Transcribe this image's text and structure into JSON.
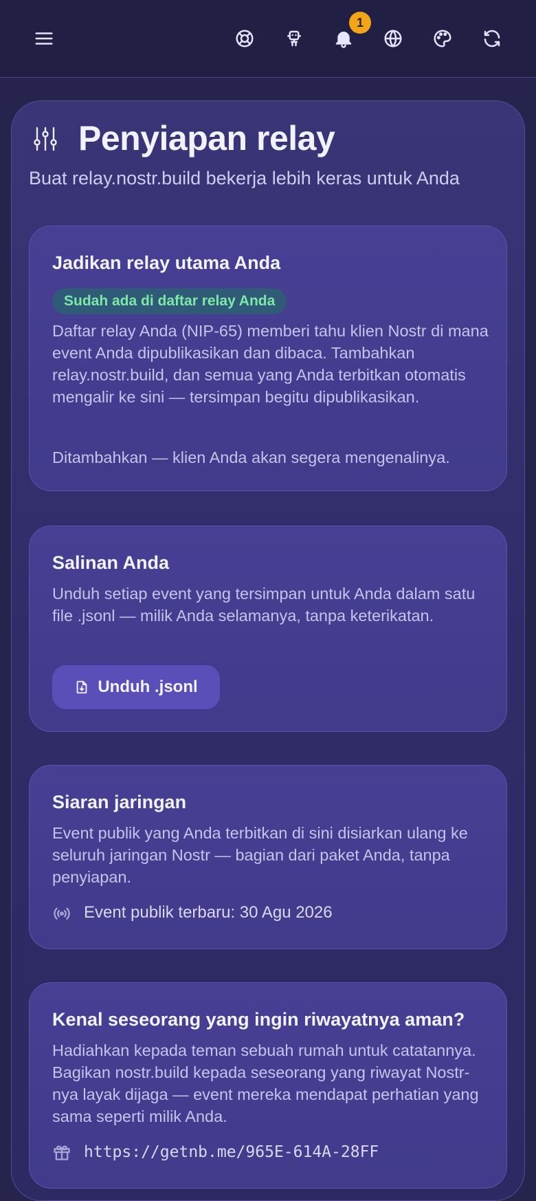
{
  "topbar": {
    "icons": [
      "menu-icon",
      "lifebuoy-icon",
      "robot-icon",
      "bell-icon",
      "globe-icon",
      "palette-icon",
      "refresh-icon"
    ],
    "notification_count": "1",
    "badge_color": "#f2a516"
  },
  "header": {
    "title": "Penyiapan relay",
    "subtitle": "Buat relay.nostr.build bekerja lebih keras untuk Anda"
  },
  "cards": {
    "primary": {
      "title": "Jadikan relay utama Anda",
      "status": "Sudah ada di daftar relay Anda",
      "description": "Daftar relay Anda (NIP-65) memberi tahu klien Nostr di mana event Anda dipublikasikan dan dibaca. Tambahkan relay.nostr.build, dan semua yang Anda terbitkan otomatis mengalir ke sini — tersimpan begitu dipublikasikan.",
      "note": "Ditambahkan — klien Anda akan segera mengenalinya."
    },
    "backup": {
      "title": "Salinan Anda",
      "description": "Unduh setiap event yang tersimpan untuk Anda dalam satu file .jsonl — milik Anda selamanya, tanpa keterikatan.",
      "button_label": "Unduh .jsonl"
    },
    "broadcast": {
      "title": "Siaran jaringan",
      "description": "Event publik yang Anda terbitkan di sini disiarkan ulang ke seluruh jaringan Nostr — bagian dari paket Anda, tanpa penyiapan.",
      "latest": "Event publik terbaru: 30 Agu 2026"
    },
    "gift": {
      "title": "Kenal seseorang yang ingin riwayatnya aman?",
      "description": "Hadiahkan kepada teman sebuah rumah untuk catatannya. Bagikan nostr.build kepada seseorang yang riwayat Nostr-nya layak dijaga — event mereka mendapat perhatian yang sama seperti milik Anda.",
      "link": "https://getnb.me/965E-614A-28FF"
    }
  }
}
